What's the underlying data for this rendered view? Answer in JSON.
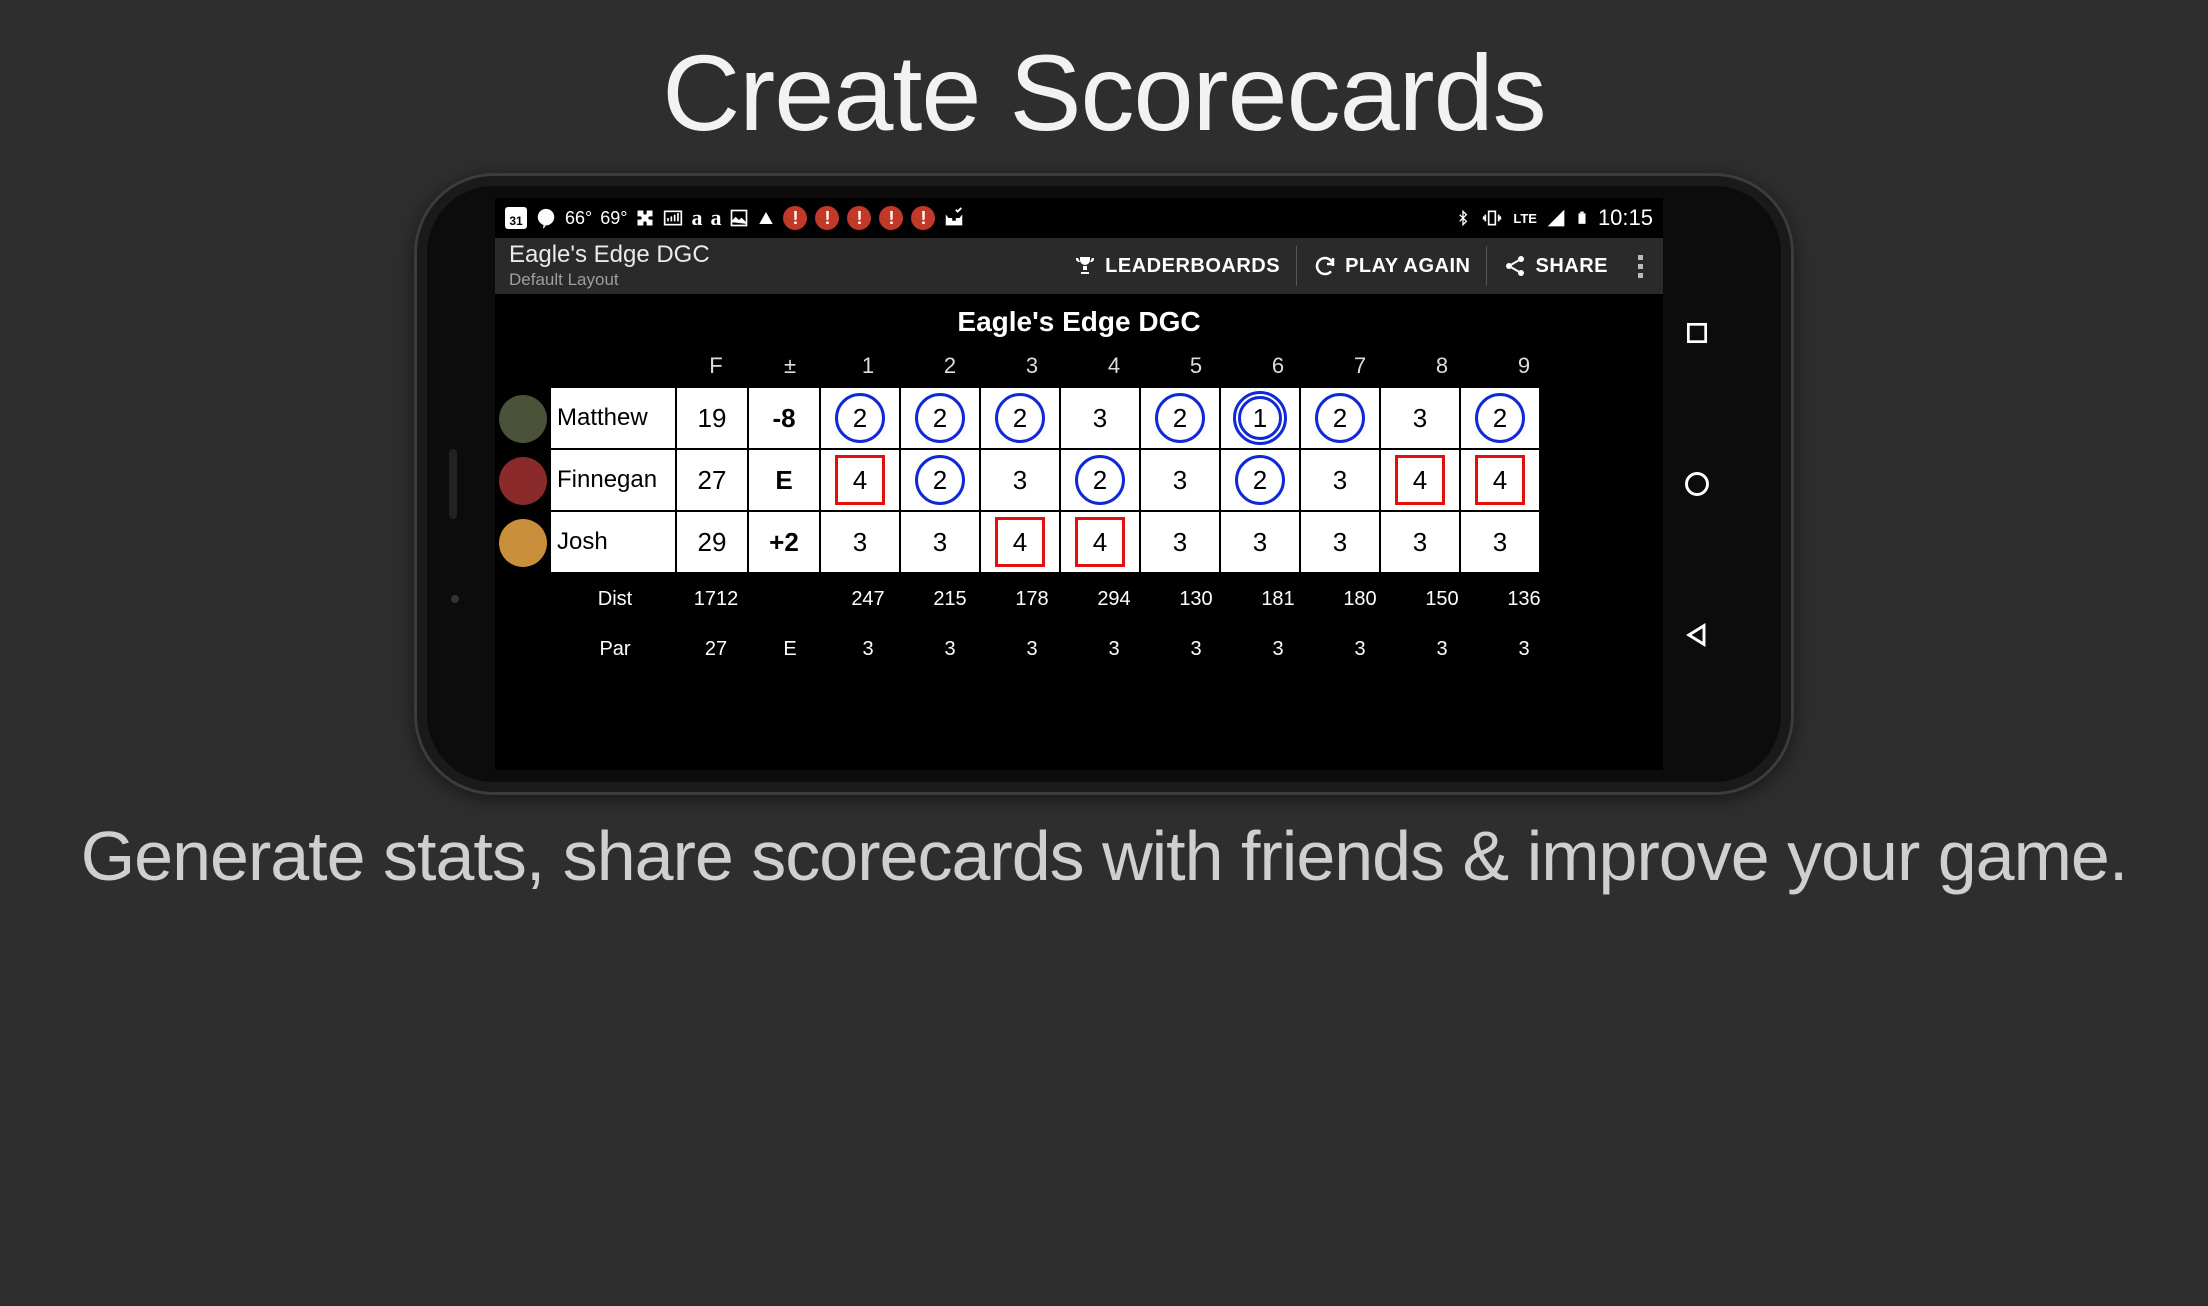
{
  "promo": {
    "title": "Create Scorecards",
    "subtitle": "Generate stats, share scorecards with friends & improve your game."
  },
  "status_bar": {
    "calendar_day": "31",
    "temps": [
      "66°",
      "69°"
    ],
    "lte_label": "LTE",
    "time": "10:15"
  },
  "app_bar": {
    "title": "Eagle's Edge DGC",
    "subtitle": "Default Layout",
    "actions": {
      "leaderboards": "LEADERBOARDS",
      "play_again": "PLAY AGAIN",
      "share": "SHARE"
    }
  },
  "course_name": "Eagle's Edge DGC",
  "headers": {
    "final": "F",
    "plus_minus": "±",
    "holes": [
      "1",
      "2",
      "3",
      "4",
      "5",
      "6",
      "7",
      "8",
      "9"
    ]
  },
  "players": [
    {
      "name": "Matthew",
      "avatar_color": "#4a5238",
      "final": "19",
      "plus_minus": "-8",
      "scores": [
        {
          "v": "2",
          "mark": "birdie"
        },
        {
          "v": "2",
          "mark": "birdie"
        },
        {
          "v": "2",
          "mark": "birdie"
        },
        {
          "v": "3",
          "mark": ""
        },
        {
          "v": "2",
          "mark": "birdie"
        },
        {
          "v": "1",
          "mark": "eagle"
        },
        {
          "v": "2",
          "mark": "birdie"
        },
        {
          "v": "3",
          "mark": ""
        },
        {
          "v": "2",
          "mark": "birdie"
        }
      ]
    },
    {
      "name": "Finnegan",
      "avatar_color": "#8a2a2a",
      "final": "27",
      "plus_minus": "E",
      "scores": [
        {
          "v": "4",
          "mark": "bogey"
        },
        {
          "v": "2",
          "mark": "birdie"
        },
        {
          "v": "3",
          "mark": ""
        },
        {
          "v": "2",
          "mark": "birdie"
        },
        {
          "v": "3",
          "mark": ""
        },
        {
          "v": "2",
          "mark": "birdie"
        },
        {
          "v": "3",
          "mark": ""
        },
        {
          "v": "4",
          "mark": "bogey"
        },
        {
          "v": "4",
          "mark": "bogey"
        }
      ]
    },
    {
      "name": "Josh",
      "avatar_color": "#c98f3b",
      "final": "29",
      "plus_minus": "+2",
      "scores": [
        {
          "v": "3",
          "mark": ""
        },
        {
          "v": "3",
          "mark": ""
        },
        {
          "v": "4",
          "mark": "bogey"
        },
        {
          "v": "4",
          "mark": "bogey"
        },
        {
          "v": "3",
          "mark": ""
        },
        {
          "v": "3",
          "mark": ""
        },
        {
          "v": "3",
          "mark": ""
        },
        {
          "v": "3",
          "mark": ""
        },
        {
          "v": "3",
          "mark": ""
        }
      ]
    }
  ],
  "dist": {
    "label": "Dist",
    "total": "1712",
    "holes": [
      "247",
      "215",
      "178",
      "294",
      "130",
      "181",
      "180",
      "150",
      "136"
    ]
  },
  "par": {
    "label": "Par",
    "total": "27",
    "relative": "E",
    "holes": [
      "3",
      "3",
      "3",
      "3",
      "3",
      "3",
      "3",
      "3",
      "3"
    ]
  }
}
